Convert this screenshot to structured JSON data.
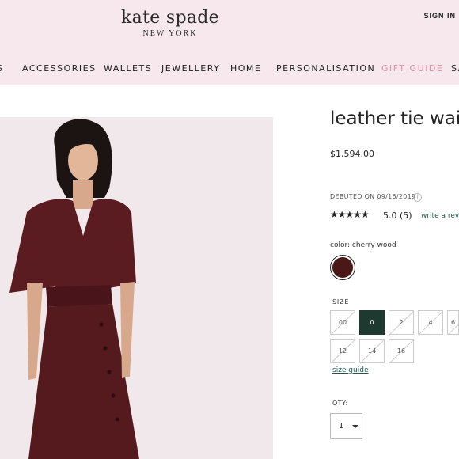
{
  "header": {
    "brand_name": "kate spade",
    "brand_sub": "NEW YORK",
    "signin": "SIGN IN",
    "nav": [
      {
        "label": "S"
      },
      {
        "label": "ACCESSORIES"
      },
      {
        "label": "WALLETS"
      },
      {
        "label": "JEWELLERY"
      },
      {
        "label": "HOME"
      },
      {
        "label": "PERSONALISATION"
      },
      {
        "label": "GIFT GUIDE"
      },
      {
        "label": "SA"
      }
    ]
  },
  "colors": {
    "header_bg": "#f6e8ec",
    "gift_guide": "#e78ba5",
    "swatch": "#4b1818",
    "selected_size": "#1e3a30",
    "link": "#1f5a4a"
  },
  "product": {
    "title": "leather tie waist",
    "price": "$1,594.00",
    "debut": "DEBUTED ON 09/16/2019",
    "info_icon": "i",
    "stars": "★★★★★",
    "rating": "5.0 (5)",
    "review_link": "write a rev",
    "color_label": "color: cherry wood",
    "size_label": "SIZE",
    "sizes": [
      {
        "label": "00",
        "state": "unavailable"
      },
      {
        "label": "0",
        "state": "selected"
      },
      {
        "label": "2",
        "state": "unavailable"
      },
      {
        "label": "4",
        "state": "unavailable"
      },
      {
        "label": "6",
        "state": "unavailable"
      },
      {
        "label": "12",
        "state": "unavailable"
      },
      {
        "label": "14",
        "state": "unavailable"
      },
      {
        "label": "16",
        "state": "unavailable"
      }
    ],
    "size_guide": "size guide",
    "qty_label": "QTY:",
    "qty_value": "1"
  }
}
